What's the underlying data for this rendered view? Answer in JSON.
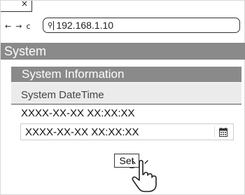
{
  "browser": {
    "tab_close_glyph": "×",
    "nav": {
      "back": "←",
      "forward": "→",
      "reload": "c"
    },
    "address": {
      "search_glyph": "⚲",
      "url": "192.168.1.10"
    }
  },
  "page": {
    "title": "System",
    "section": {
      "title": "System Information",
      "field_label": "System DateTime",
      "current_value": "XXXX-XX-XX XX:XX:XX",
      "input_value": "XXXX-XX-XX XX:XX:XX",
      "set_label": "Set"
    }
  },
  "colors": {
    "header_bg": "#8a8a8a",
    "subheader_bg": "#ebebeb"
  },
  "icons": [
    "close-icon",
    "back-arrow-icon",
    "forward-arrow-icon",
    "reload-icon",
    "search-icon",
    "calendar-icon",
    "pointer-hand-icon"
  ]
}
